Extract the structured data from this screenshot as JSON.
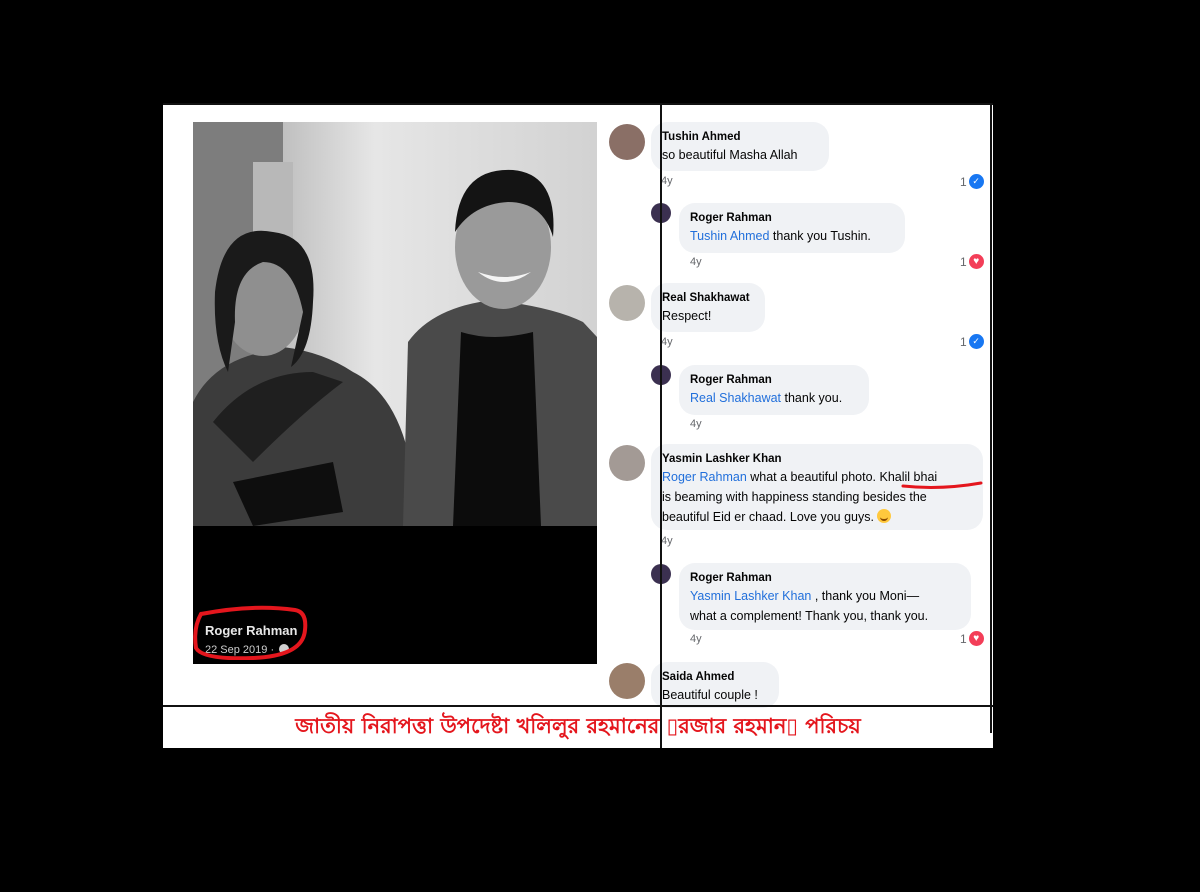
{
  "post": {
    "author": "Roger Rahman",
    "date": "22 Sep 2019 ·"
  },
  "comments": [
    {
      "name": "Tushin Ahmed",
      "text": "so beautiful Masha Allah",
      "age": "4y",
      "reaction_count": "1",
      "reaction": "like-icon"
    },
    {
      "name": "Roger Rahman",
      "mention": "Tushin Ahmed",
      "text": " thank you Tushin.",
      "age": "4y",
      "reaction_count": "1",
      "reaction": "love-icon"
    },
    {
      "name": "Real Shakhawat",
      "text": "Respect!",
      "age": "4y",
      "reaction_count": "1",
      "reaction": "like-icon"
    },
    {
      "name": "Roger Rahman",
      "mention": "Real Shakhawat",
      "text": " thank you.",
      "age": "4y"
    },
    {
      "name": "Yasmin Lashker Khan",
      "mention": "Roger Rahman",
      "text_1": " what a beautiful photo. ",
      "highlight": "Khalil bhai",
      "text_2": "is beaming with happiness standing besides the",
      "text_3": "beautiful Eid er chaad. Love you guys. ",
      "age": "4y",
      "emoji": "smiling-face-with-hearts-emoji"
    },
    {
      "name": "Roger Rahman",
      "mention": "Yasmin Lashker Khan",
      "text_1": " , thank you Moni—",
      "text_2": "what a complement! Thank you, thank you.",
      "age": "4y",
      "reaction_count": "1",
      "reaction": "love-icon"
    },
    {
      "name": "Saida Ahmed",
      "text": "Beautiful couple !"
    }
  ],
  "caption": "জাতীয় নিরাপত্তা উপদেষ্টা খলিলুর রহমানের ▯রজার রহমান▯ পরিচয়",
  "colors": {
    "mention": "#216fdb",
    "annotation": "#e4161d",
    "like": "#1877f2",
    "love": "#f33e58"
  }
}
